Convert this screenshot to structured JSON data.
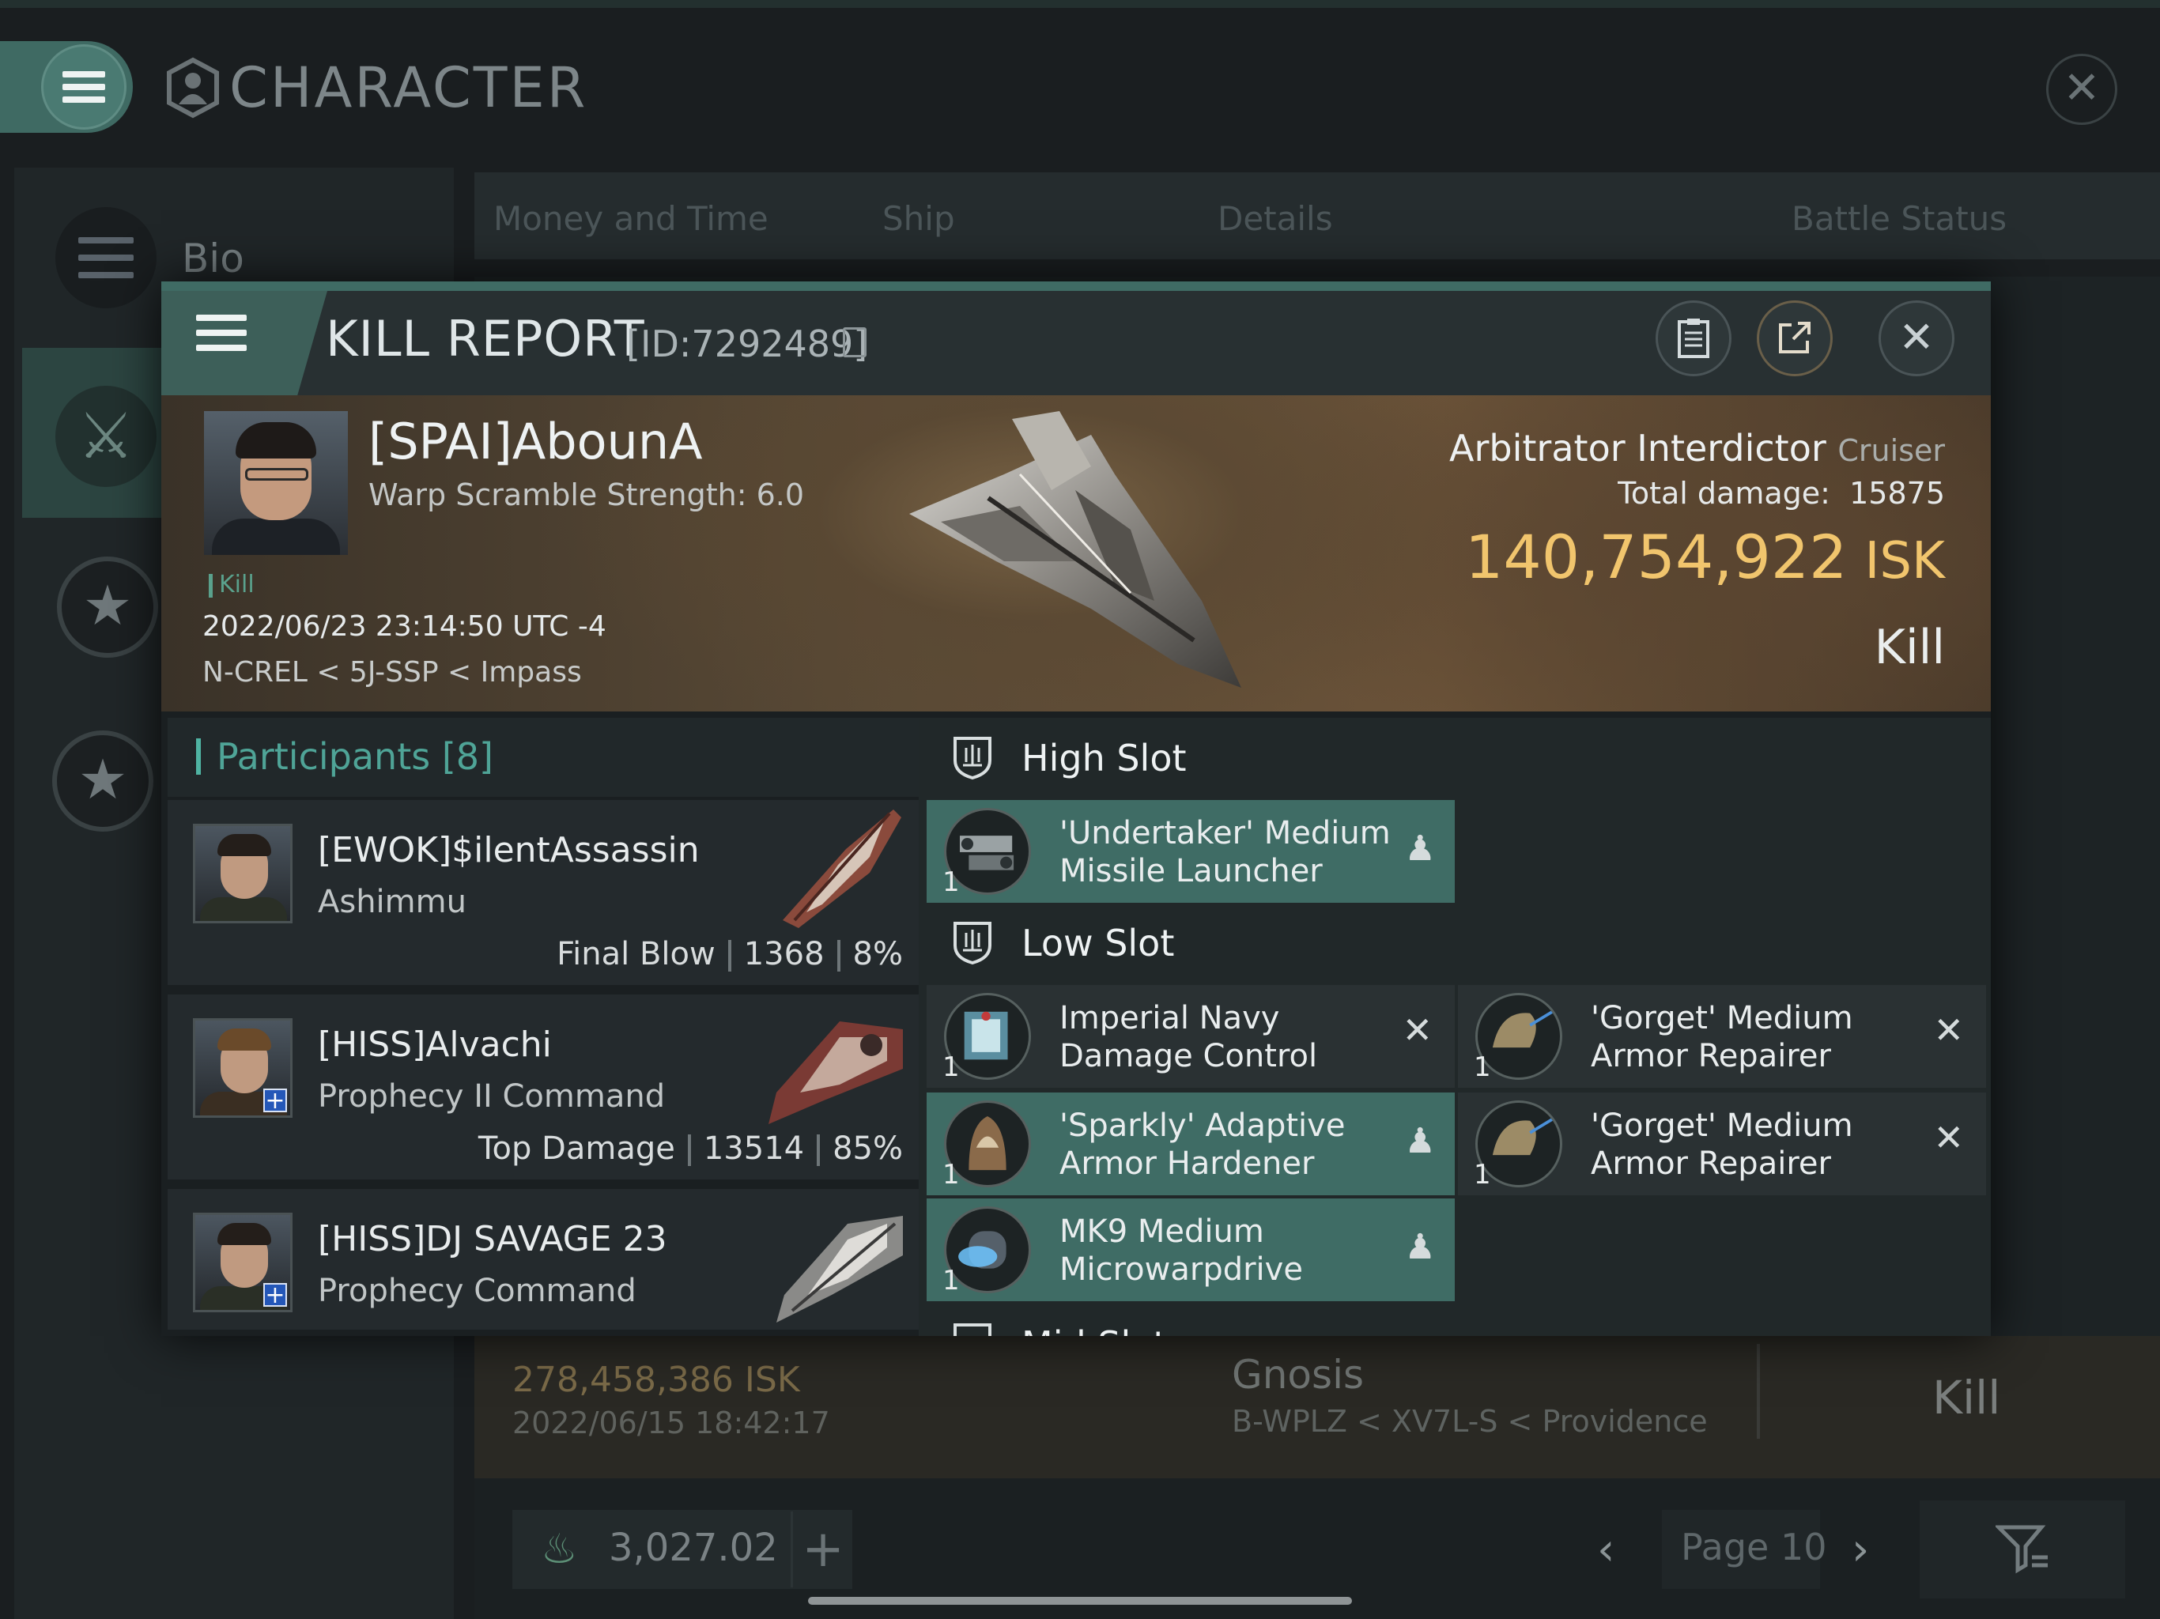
{
  "app": {
    "title": "CHARACTER",
    "sidebar": {
      "bio_label": "Bio"
    },
    "tabs": [
      "Money and Time",
      "Ship",
      "Details",
      "Battle Status"
    ],
    "background_row": {
      "isk": "278,458,386  ISK",
      "date": "2022/06/15  18:42:17",
      "ship": "Gnosis",
      "location": "B-WPLZ < XV7L-S < Providence",
      "result": "Kill"
    },
    "wallet": {
      "value": "3,027.02"
    },
    "pager": {
      "label": "Page 10"
    }
  },
  "kill_report": {
    "title": "KILL REPORT",
    "id": "[ID:7292489]",
    "victim": {
      "name": "[SPAI]AbounA",
      "warp": "Warp Scramble Strength: 6.0",
      "tag": "Kill",
      "timestamp": "2022/06/23 23:14:50 UTC -4",
      "location": "N-CREL < 5J-SSP < Impass"
    },
    "ship": {
      "name": "Arbitrator Interdictor",
      "class": "Cruiser",
      "total_damage_label": "Total damage:",
      "total_damage": "15875",
      "isk_value": "140,754,922",
      "isk_unit": "ISK",
      "result": "Kill"
    },
    "participants": {
      "label": "Participants",
      "count": "[8]",
      "rows": [
        {
          "name": "[EWOK]$ilentAssassin",
          "ship": "Ashimmu",
          "role": "Final Blow",
          "damage": "1368",
          "percent": "8%"
        },
        {
          "name": "[HISS]Alvachi",
          "ship": "Prophecy II Command",
          "role": "Top Damage",
          "damage": "13514",
          "percent": "85%"
        },
        {
          "name": "[HISS]DJ SAVAGE 23",
          "ship": "Prophecy Command"
        }
      ]
    },
    "fitting": {
      "high_slot_label": "High Slot",
      "low_slot_label": "Low Slot",
      "next_slot_partial": "Mid Slot",
      "high": [
        {
          "line1": "'Undertaker' Medium",
          "line2": "Missile Launcher",
          "qty": "1",
          "state": "fitted"
        }
      ],
      "low": [
        {
          "line1": "Imperial Navy",
          "line2": "Damage Control",
          "qty": "1",
          "state": "destroyed"
        },
        {
          "line1": "'Gorget' Medium",
          "line2": "Armor Repairer",
          "qty": "1",
          "state": "destroyed"
        },
        {
          "line1": "'Sparkly' Adaptive",
          "line2": "Armor Hardener",
          "qty": "1",
          "state": "fitted"
        },
        {
          "line1": "'Gorget' Medium",
          "line2": "Armor Repairer",
          "qty": "1",
          "state": "destroyed"
        },
        {
          "line1": "MK9 Medium",
          "line2": "Microwarpdrive",
          "qty": "1",
          "state": "fitted"
        }
      ]
    }
  },
  "colors": {
    "accent_teal": "#3f6c65",
    "isk_gold": "#f1c56d",
    "participants_teal": "#4fa497"
  }
}
